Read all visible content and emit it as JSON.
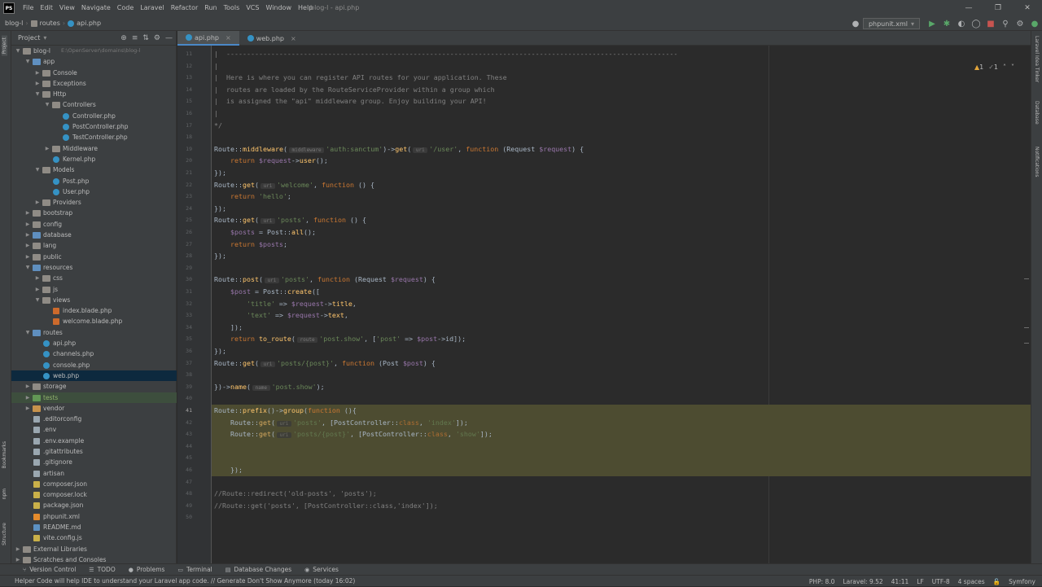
{
  "app": {
    "logo": "PS",
    "window_title": "blog-l - api.php"
  },
  "menu": [
    "File",
    "Edit",
    "View",
    "Navigate",
    "Code",
    "Laravel",
    "Refactor",
    "Run",
    "Tools",
    "VCS",
    "Window",
    "Help"
  ],
  "breadcrumb": {
    "project": "blog-l",
    "folder": "routes",
    "file": "api.php"
  },
  "toolbar": {
    "run_config": "phpunit.xml"
  },
  "project_panel": {
    "title": "Project"
  },
  "tree": [
    {
      "label": "blog-l",
      "sub": "E:\\OpenServer\\domains\\blog-l",
      "level": 1,
      "type": "folder",
      "open": true
    },
    {
      "label": "app",
      "level": 2,
      "type": "folder",
      "open": true
    },
    {
      "label": "Console",
      "level": 3,
      "type": "folder"
    },
    {
      "label": "Exceptions",
      "level": 3,
      "type": "folder"
    },
    {
      "label": "Http",
      "level": 3,
      "type": "folder",
      "open": true
    },
    {
      "label": "Controllers",
      "level": 4,
      "type": "folder",
      "open": true
    },
    {
      "label": "Controller.php",
      "level": 5,
      "type": "php"
    },
    {
      "label": "PostController.php",
      "level": 5,
      "type": "php"
    },
    {
      "label": "TestController.php",
      "level": 5,
      "type": "php"
    },
    {
      "label": "Middleware",
      "level": 4,
      "type": "folder"
    },
    {
      "label": "Kernel.php",
      "level": 4,
      "type": "php"
    },
    {
      "label": "Models",
      "level": 3,
      "type": "folder",
      "open": true
    },
    {
      "label": "Post.php",
      "level": 4,
      "type": "php"
    },
    {
      "label": "User.php",
      "level": 4,
      "type": "php"
    },
    {
      "label": "Providers",
      "level": 3,
      "type": "folder"
    },
    {
      "label": "bootstrap",
      "level": 2,
      "type": "folder"
    },
    {
      "label": "config",
      "level": 2,
      "type": "folder"
    },
    {
      "label": "database",
      "level": 2,
      "type": "folder"
    },
    {
      "label": "lang",
      "level": 2,
      "type": "folder"
    },
    {
      "label": "public",
      "level": 2,
      "type": "folder"
    },
    {
      "label": "resources",
      "level": 2,
      "type": "folder",
      "open": true
    },
    {
      "label": "css",
      "level": 3,
      "type": "folder"
    },
    {
      "label": "js",
      "level": 3,
      "type": "folder"
    },
    {
      "label": "views",
      "level": 3,
      "type": "folder",
      "open": true
    },
    {
      "label": "index.blade.php",
      "level": 4,
      "type": "blade"
    },
    {
      "label": "welcome.blade.php",
      "level": 4,
      "type": "blade"
    },
    {
      "label": "routes",
      "level": 2,
      "type": "folder",
      "open": true
    },
    {
      "label": "api.php",
      "level": 3,
      "type": "php"
    },
    {
      "label": "channels.php",
      "level": 3,
      "type": "php"
    },
    {
      "label": "console.php",
      "level": 3,
      "type": "php"
    },
    {
      "label": "web.php",
      "level": 3,
      "type": "php",
      "selected": true
    },
    {
      "label": "storage",
      "level": 2,
      "type": "folder"
    },
    {
      "label": "tests",
      "level": 2,
      "type": "folder-green",
      "lib": true
    },
    {
      "label": "vendor",
      "level": 2,
      "type": "folder-orange"
    },
    {
      "label": ".editorconfig",
      "level": 2,
      "type": "plain"
    },
    {
      "label": ".env",
      "level": 2,
      "type": "plain"
    },
    {
      "label": ".env.example",
      "level": 2,
      "type": "plain"
    },
    {
      "label": ".gitattributes",
      "level": 2,
      "type": "plain"
    },
    {
      "label": ".gitignore",
      "level": 2,
      "type": "plain"
    },
    {
      "label": "artisan",
      "level": 2,
      "type": "plain"
    },
    {
      "label": "composer.json",
      "level": 2,
      "type": "json"
    },
    {
      "label": "composer.lock",
      "level": 2,
      "type": "json"
    },
    {
      "label": "package.json",
      "level": 2,
      "type": "json"
    },
    {
      "label": "phpunit.xml",
      "level": 2,
      "type": "xml"
    },
    {
      "label": "README.md",
      "level": 2,
      "type": "md"
    },
    {
      "label": "vite.config.js",
      "level": 2,
      "type": "json"
    },
    {
      "label": "External Libraries",
      "level": 1,
      "type": "folder"
    },
    {
      "label": "Scratches and Consoles",
      "level": 1,
      "type": "folder"
    }
  ],
  "tabs": [
    {
      "label": "api.php",
      "active": true
    },
    {
      "label": "web.php",
      "active": false
    }
  ],
  "inspections": {
    "warnings": "1",
    "weak": "1"
  },
  "code_lines": [
    {
      "n": "11",
      "segs": [
        [
          "|  ---------------------------------------------------------------------------------------------------------------",
          "c"
        ]
      ]
    },
    {
      "n": "12",
      "segs": [
        [
          "|",
          "c"
        ]
      ]
    },
    {
      "n": "13",
      "segs": [
        [
          "|  Here is where you can register API routes for your application. These",
          "c"
        ]
      ]
    },
    {
      "n": "14",
      "segs": [
        [
          "|  routes are loaded by the RouteServiceProvider within a group which",
          "c"
        ]
      ]
    },
    {
      "n": "15",
      "segs": [
        [
          "|  is assigned the \"api\" middleware group. Enjoy building your API!",
          "c"
        ]
      ]
    },
    {
      "n": "16",
      "segs": [
        [
          "|",
          "c"
        ]
      ]
    },
    {
      "n": "17",
      "segs": [
        [
          "*/",
          "c"
        ]
      ]
    },
    {
      "n": "18",
      "segs": []
    },
    {
      "n": "19",
      "segs": [
        [
          "Route",
          "t"
        ],
        [
          "::",
          "p"
        ],
        [
          "middleware",
          "f"
        ],
        [
          "(",
          "p"
        ],
        [
          " middleware ",
          "h"
        ],
        [
          "'auth:sanctum'",
          "s"
        ],
        [
          ")->",
          "p"
        ],
        [
          "get",
          "f"
        ],
        [
          "(",
          "p"
        ],
        [
          " uri ",
          "h"
        ],
        [
          "'/user'",
          "s"
        ],
        [
          ", ",
          "p"
        ],
        [
          "function ",
          "k"
        ],
        [
          "(Request ",
          "t"
        ],
        [
          "$request",
          "v"
        ],
        [
          ") {",
          "p"
        ]
      ]
    },
    {
      "n": "20",
      "segs": [
        [
          "    return ",
          "k"
        ],
        [
          "$request",
          "v"
        ],
        [
          "->",
          "p"
        ],
        [
          "user",
          "m"
        ],
        [
          "();",
          "p"
        ]
      ]
    },
    {
      "n": "21",
      "segs": [
        [
          "});",
          "p"
        ]
      ]
    },
    {
      "n": "22",
      "segs": [
        [
          "Route",
          "t"
        ],
        [
          "::",
          "p"
        ],
        [
          "get",
          "f"
        ],
        [
          "(",
          "p"
        ],
        [
          " uri ",
          "h"
        ],
        [
          "'welcome'",
          "s"
        ],
        [
          ", ",
          "p"
        ],
        [
          "function ",
          "k"
        ],
        [
          "() {",
          "p"
        ]
      ]
    },
    {
      "n": "23",
      "segs": [
        [
          "    return ",
          "k"
        ],
        [
          "'hello'",
          "s"
        ],
        [
          ";",
          "p"
        ]
      ]
    },
    {
      "n": "24",
      "segs": [
        [
          "});",
          "p"
        ]
      ]
    },
    {
      "n": "25",
      "segs": [
        [
          "Route",
          "t"
        ],
        [
          "::",
          "p"
        ],
        [
          "get",
          "f"
        ],
        [
          "(",
          "p"
        ],
        [
          " uri ",
          "h"
        ],
        [
          "'posts'",
          "s"
        ],
        [
          ", ",
          "p"
        ],
        [
          "function ",
          "k"
        ],
        [
          "() {",
          "p"
        ]
      ]
    },
    {
      "n": "26",
      "segs": [
        [
          "    ",
          "p"
        ],
        [
          "$posts",
          "v"
        ],
        [
          " = ",
          "p"
        ],
        [
          "Post",
          "t"
        ],
        [
          "::",
          "p"
        ],
        [
          "all",
          "m"
        ],
        [
          "();",
          "p"
        ]
      ]
    },
    {
      "n": "27",
      "segs": [
        [
          "    return ",
          "k"
        ],
        [
          "$posts",
          "v"
        ],
        [
          ";",
          "p"
        ]
      ]
    },
    {
      "n": "28",
      "segs": [
        [
          "});",
          "p"
        ]
      ]
    },
    {
      "n": "29",
      "segs": []
    },
    {
      "n": "30",
      "segs": [
        [
          "Route",
          "t"
        ],
        [
          "::",
          "p"
        ],
        [
          "post",
          "f"
        ],
        [
          "(",
          "p"
        ],
        [
          " uri ",
          "h"
        ],
        [
          "'posts'",
          "s"
        ],
        [
          ", ",
          "p"
        ],
        [
          "function ",
          "k"
        ],
        [
          "(Request ",
          "t"
        ],
        [
          "$request",
          "v"
        ],
        [
          ") {",
          "p"
        ]
      ]
    },
    {
      "n": "31",
      "segs": [
        [
          "    ",
          "p"
        ],
        [
          "$post",
          "v"
        ],
        [
          " = ",
          "p"
        ],
        [
          "Post",
          "t"
        ],
        [
          "::",
          "p"
        ],
        [
          "create",
          "m"
        ],
        [
          "([",
          "p"
        ]
      ]
    },
    {
      "n": "32",
      "segs": [
        [
          "        ",
          "p"
        ],
        [
          "'title'",
          "s"
        ],
        [
          " => ",
          "p"
        ],
        [
          "$request",
          "v"
        ],
        [
          "->",
          "p"
        ],
        [
          "title",
          "m"
        ],
        [
          ",",
          "p"
        ]
      ]
    },
    {
      "n": "33",
      "segs": [
        [
          "        ",
          "p"
        ],
        [
          "'text'",
          "s"
        ],
        [
          " => ",
          "p"
        ],
        [
          "$request",
          "v"
        ],
        [
          "->",
          "p"
        ],
        [
          "text",
          "m"
        ],
        [
          ",",
          "p"
        ]
      ]
    },
    {
      "n": "34",
      "segs": [
        [
          "    ]);",
          "p"
        ]
      ]
    },
    {
      "n": "35",
      "segs": [
        [
          "    return ",
          "k"
        ],
        [
          "to_route",
          "f"
        ],
        [
          "(",
          "p"
        ],
        [
          " route ",
          "h"
        ],
        [
          "'post.show'",
          "s"
        ],
        [
          ", [",
          "p"
        ],
        [
          "'post'",
          "s"
        ],
        [
          " => ",
          "p"
        ],
        [
          "$post",
          "v"
        ],
        [
          "->id]);",
          "p"
        ]
      ]
    },
    {
      "n": "36",
      "segs": [
        [
          "});",
          "p"
        ]
      ]
    },
    {
      "n": "37",
      "segs": [
        [
          "Route",
          "t"
        ],
        [
          "::",
          "p"
        ],
        [
          "get",
          "f"
        ],
        [
          "(",
          "p"
        ],
        [
          " uri ",
          "h"
        ],
        [
          "'posts/{post}'",
          "s"
        ],
        [
          ", ",
          "p"
        ],
        [
          "function ",
          "k"
        ],
        [
          "(Post ",
          "t"
        ],
        [
          "$post",
          "v"
        ],
        [
          ") {",
          "p"
        ]
      ]
    },
    {
      "n": "38",
      "segs": []
    },
    {
      "n": "39",
      "segs": [
        [
          "})->",
          "p"
        ],
        [
          "name",
          "f"
        ],
        [
          "(",
          "p"
        ],
        [
          " name ",
          "h"
        ],
        [
          "'post.show'",
          "s"
        ],
        [
          ");",
          "p"
        ]
      ]
    },
    {
      "n": "40",
      "segs": []
    },
    {
      "n": "41",
      "segs": [
        [
          "Route",
          "t"
        ],
        [
          "::",
          "p"
        ],
        [
          "prefix",
          "f"
        ],
        [
          "()",
          "p"
        ],
        [
          "->",
          "p"
        ],
        [
          "group",
          "f"
        ],
        [
          "(",
          "p"
        ],
        [
          "function ",
          "k"
        ],
        [
          "(){",
          "p"
        ]
      ],
      "hl": true,
      "cur": true
    },
    {
      "n": "42",
      "segs": [
        [
          "    Route",
          "t"
        ],
        [
          "::",
          "p"
        ],
        [
          "get",
          "f"
        ],
        [
          "(",
          "p"
        ],
        [
          " uri ",
          "h"
        ],
        [
          "'posts'",
          "s"
        ],
        [
          ", [",
          "p"
        ],
        [
          "PostController",
          "t"
        ],
        [
          "::",
          "p"
        ],
        [
          "class",
          "k"
        ],
        [
          ", ",
          "p"
        ],
        [
          "'index'",
          "s"
        ],
        [
          "]);",
          "p"
        ]
      ],
      "hl": true
    },
    {
      "n": "43",
      "segs": [
        [
          "    Route",
          "t"
        ],
        [
          "::",
          "p"
        ],
        [
          "get",
          "f"
        ],
        [
          "(",
          "p"
        ],
        [
          " uri ",
          "h"
        ],
        [
          "'posts/{post}'",
          "s"
        ],
        [
          ", [",
          "p"
        ],
        [
          "PostController",
          "t"
        ],
        [
          "::",
          "p"
        ],
        [
          "class",
          "k"
        ],
        [
          ", ",
          "p"
        ],
        [
          "'show'",
          "s"
        ],
        [
          "]);",
          "p"
        ]
      ],
      "hl": true
    },
    {
      "n": "44",
      "segs": [],
      "hl": true
    },
    {
      "n": "45",
      "segs": [],
      "hl": true
    },
    {
      "n": "46",
      "segs": [
        [
          "    });",
          "p"
        ]
      ],
      "hl": true
    },
    {
      "n": "47",
      "segs": []
    },
    {
      "n": "48",
      "segs": [
        [
          "//Route::redirect('old-posts', 'posts');",
          "c"
        ]
      ]
    },
    {
      "n": "49",
      "segs": [
        [
          "//Route::get('posts', [PostController::class,'index']);",
          "c"
        ]
      ]
    },
    {
      "n": "50",
      "segs": []
    }
  ],
  "bottom_tools": [
    "Version Control",
    "TODO",
    "Problems",
    "Terminal",
    "Database Changes",
    "Services"
  ],
  "status": {
    "message": "Helper Code will help IDE to understand your Laravel app code. // Generate   Don't Show Anymore (today 16:02)",
    "php": "PHP: 8.0",
    "laravel": "Laravel: 9.52",
    "position": "41:11",
    "line_sep": "LF",
    "encoding": "UTF-8",
    "indent": "4 spaces",
    "theme": "Symfony"
  },
  "colors": {
    "keyword": "#cc7832",
    "string": "#6a8759",
    "comment": "#808080",
    "variable": "#9876aa",
    "method": "#ffc66d",
    "text": "#a9b7c6",
    "highlight": "#4d4c31"
  },
  "stripes": {
    "left_top": "Project",
    "left_mid": "Bookmarks",
    "left_low": "npm",
    "left_bottom": "Structure",
    "right_top": "Laravel Idea Tinker",
    "right_mid": "Database",
    "right_low": "Notifications"
  }
}
